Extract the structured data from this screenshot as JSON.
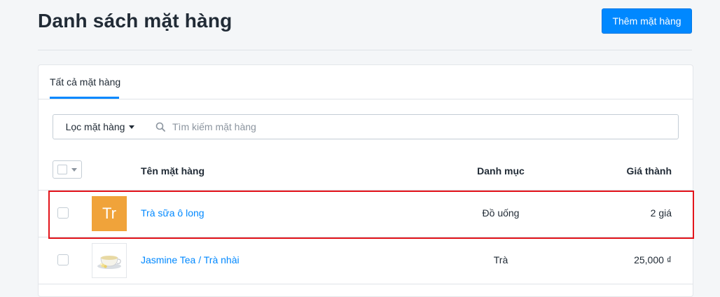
{
  "header": {
    "title": "Danh sách mặt hàng",
    "add_button_label": "Thêm mặt hàng"
  },
  "tabs": [
    {
      "label": "Tất cả mặt hàng",
      "active": true
    }
  ],
  "toolbar": {
    "filter_label": "Lọc mặt hàng",
    "search_placeholder": "Tìm kiếm mặt hàng",
    "search_value": ""
  },
  "table": {
    "columns": [
      "Tên mặt hàng",
      "Danh mục",
      "Giá thành"
    ],
    "rows": [
      {
        "thumb_text": "Tr",
        "thumb_color": "#f0a33a",
        "name": "Trà sữa ô long",
        "category": "Đồ uống",
        "price": "2 giá",
        "highlighted": true
      },
      {
        "thumb_icon": "tea-cup-image",
        "name": "Jasmine Tea / Trà nhài",
        "category": "Trà",
        "price": "25,000 ₫"
      }
    ]
  },
  "colors": {
    "accent": "#0088ff",
    "highlight": "#e3141b",
    "thumb_orange": "#f0a33a"
  },
  "icons": {
    "search": "search-icon",
    "filter_caret": "caret-down-icon",
    "bulk_caret": "caret-down-icon"
  }
}
